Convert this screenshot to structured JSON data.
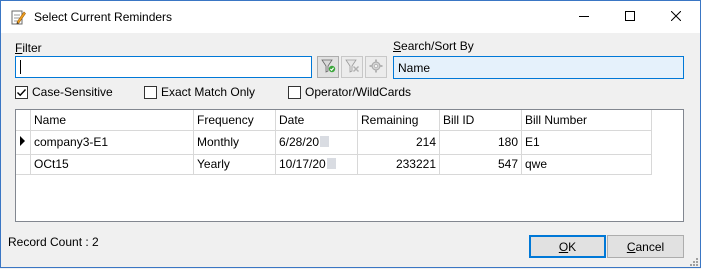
{
  "window": {
    "title": "Select Current Reminders"
  },
  "filter": {
    "label_pre": "",
    "label_u": "F",
    "label_post": "ilter",
    "value": ""
  },
  "sort": {
    "label_pre": "",
    "label_u": "S",
    "label_post": "earch/Sort By",
    "value": "Name"
  },
  "options": {
    "case_sensitive": {
      "label": "Case-Sensitive",
      "checked": true
    },
    "exact_match": {
      "label": "Exact Match Only",
      "checked": false
    },
    "operator_wildcards": {
      "label": "Operator/WildCards",
      "checked": false
    }
  },
  "table": {
    "columns": [
      "Name",
      "Frequency",
      "Date",
      "Remaining",
      "Bill ID",
      "Bill Number"
    ],
    "rows": [
      {
        "name": "company3-E1",
        "frequency": "Monthly",
        "date": "6/28/20",
        "remaining": "214",
        "bill_id": "180",
        "bill_number": "E1",
        "current": true
      },
      {
        "name": "OCt15",
        "frequency": "Yearly",
        "date": "10/17/20",
        "remaining": "233221",
        "bill_id": "547",
        "bill_number": "qwe",
        "current": false
      }
    ]
  },
  "status": {
    "record_count": "Record Count : 2"
  },
  "buttons": {
    "ok": {
      "u": "O",
      "rest": "K"
    },
    "cancel": {
      "u": "C",
      "rest": "ancel"
    }
  },
  "icons": {
    "app": "notepad-pencil-icon",
    "minimize": "minimize-icon",
    "maximize": "maximize-icon",
    "close": "close-icon",
    "filter_apply": "funnel-apply-icon",
    "filter_clear": "funnel-clear-icon",
    "filter_options": "gear-icon"
  },
  "colors": {
    "accent": "#0078d7",
    "sort_bg": "#e5f1fb",
    "window_bg": "#f0f0f0"
  }
}
